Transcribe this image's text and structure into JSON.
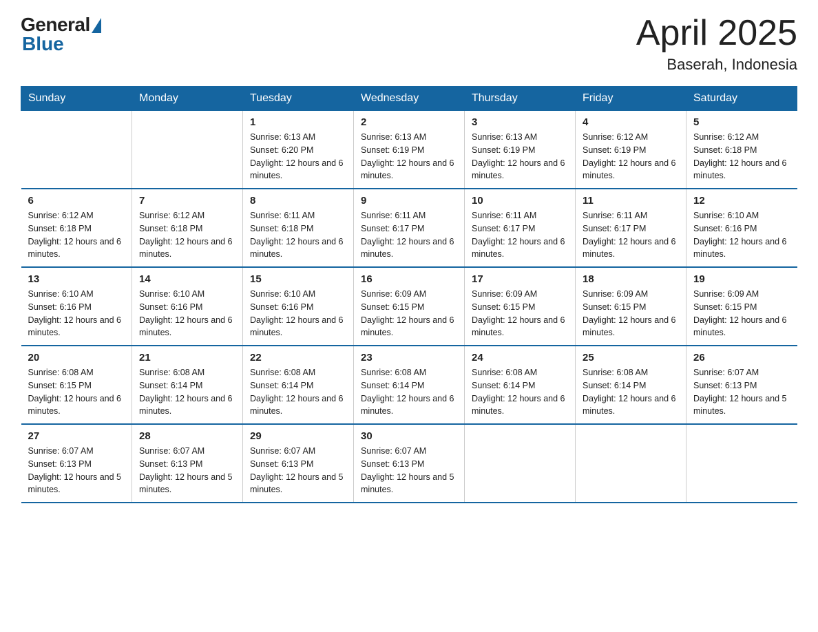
{
  "header": {
    "logo_general": "General",
    "logo_blue": "Blue",
    "title": "April 2025",
    "subtitle": "Baserah, Indonesia"
  },
  "days_of_week": [
    "Sunday",
    "Monday",
    "Tuesday",
    "Wednesday",
    "Thursday",
    "Friday",
    "Saturday"
  ],
  "weeks": [
    [
      {
        "day": "",
        "sunrise": "",
        "sunset": "",
        "daylight": ""
      },
      {
        "day": "",
        "sunrise": "",
        "sunset": "",
        "daylight": ""
      },
      {
        "day": "1",
        "sunrise": "6:13 AM",
        "sunset": "6:20 PM",
        "daylight": "12 hours and 6 minutes."
      },
      {
        "day": "2",
        "sunrise": "6:13 AM",
        "sunset": "6:19 PM",
        "daylight": "12 hours and 6 minutes."
      },
      {
        "day": "3",
        "sunrise": "6:13 AM",
        "sunset": "6:19 PM",
        "daylight": "12 hours and 6 minutes."
      },
      {
        "day": "4",
        "sunrise": "6:12 AM",
        "sunset": "6:19 PM",
        "daylight": "12 hours and 6 minutes."
      },
      {
        "day": "5",
        "sunrise": "6:12 AM",
        "sunset": "6:18 PM",
        "daylight": "12 hours and 6 minutes."
      }
    ],
    [
      {
        "day": "6",
        "sunrise": "6:12 AM",
        "sunset": "6:18 PM",
        "daylight": "12 hours and 6 minutes."
      },
      {
        "day": "7",
        "sunrise": "6:12 AM",
        "sunset": "6:18 PM",
        "daylight": "12 hours and 6 minutes."
      },
      {
        "day": "8",
        "sunrise": "6:11 AM",
        "sunset": "6:18 PM",
        "daylight": "12 hours and 6 minutes."
      },
      {
        "day": "9",
        "sunrise": "6:11 AM",
        "sunset": "6:17 PM",
        "daylight": "12 hours and 6 minutes."
      },
      {
        "day": "10",
        "sunrise": "6:11 AM",
        "sunset": "6:17 PM",
        "daylight": "12 hours and 6 minutes."
      },
      {
        "day": "11",
        "sunrise": "6:11 AM",
        "sunset": "6:17 PM",
        "daylight": "12 hours and 6 minutes."
      },
      {
        "day": "12",
        "sunrise": "6:10 AM",
        "sunset": "6:16 PM",
        "daylight": "12 hours and 6 minutes."
      }
    ],
    [
      {
        "day": "13",
        "sunrise": "6:10 AM",
        "sunset": "6:16 PM",
        "daylight": "12 hours and 6 minutes."
      },
      {
        "day": "14",
        "sunrise": "6:10 AM",
        "sunset": "6:16 PM",
        "daylight": "12 hours and 6 minutes."
      },
      {
        "day": "15",
        "sunrise": "6:10 AM",
        "sunset": "6:16 PM",
        "daylight": "12 hours and 6 minutes."
      },
      {
        "day": "16",
        "sunrise": "6:09 AM",
        "sunset": "6:15 PM",
        "daylight": "12 hours and 6 minutes."
      },
      {
        "day": "17",
        "sunrise": "6:09 AM",
        "sunset": "6:15 PM",
        "daylight": "12 hours and 6 minutes."
      },
      {
        "day": "18",
        "sunrise": "6:09 AM",
        "sunset": "6:15 PM",
        "daylight": "12 hours and 6 minutes."
      },
      {
        "day": "19",
        "sunrise": "6:09 AM",
        "sunset": "6:15 PM",
        "daylight": "12 hours and 6 minutes."
      }
    ],
    [
      {
        "day": "20",
        "sunrise": "6:08 AM",
        "sunset": "6:15 PM",
        "daylight": "12 hours and 6 minutes."
      },
      {
        "day": "21",
        "sunrise": "6:08 AM",
        "sunset": "6:14 PM",
        "daylight": "12 hours and 6 minutes."
      },
      {
        "day": "22",
        "sunrise": "6:08 AM",
        "sunset": "6:14 PM",
        "daylight": "12 hours and 6 minutes."
      },
      {
        "day": "23",
        "sunrise": "6:08 AM",
        "sunset": "6:14 PM",
        "daylight": "12 hours and 6 minutes."
      },
      {
        "day": "24",
        "sunrise": "6:08 AM",
        "sunset": "6:14 PM",
        "daylight": "12 hours and 6 minutes."
      },
      {
        "day": "25",
        "sunrise": "6:08 AM",
        "sunset": "6:14 PM",
        "daylight": "12 hours and 6 minutes."
      },
      {
        "day": "26",
        "sunrise": "6:07 AM",
        "sunset": "6:13 PM",
        "daylight": "12 hours and 5 minutes."
      }
    ],
    [
      {
        "day": "27",
        "sunrise": "6:07 AM",
        "sunset": "6:13 PM",
        "daylight": "12 hours and 5 minutes."
      },
      {
        "day": "28",
        "sunrise": "6:07 AM",
        "sunset": "6:13 PM",
        "daylight": "12 hours and 5 minutes."
      },
      {
        "day": "29",
        "sunrise": "6:07 AM",
        "sunset": "6:13 PM",
        "daylight": "12 hours and 5 minutes."
      },
      {
        "day": "30",
        "sunrise": "6:07 AM",
        "sunset": "6:13 PM",
        "daylight": "12 hours and 5 minutes."
      },
      {
        "day": "",
        "sunrise": "",
        "sunset": "",
        "daylight": ""
      },
      {
        "day": "",
        "sunrise": "",
        "sunset": "",
        "daylight": ""
      },
      {
        "day": "",
        "sunrise": "",
        "sunset": "",
        "daylight": ""
      }
    ]
  ]
}
